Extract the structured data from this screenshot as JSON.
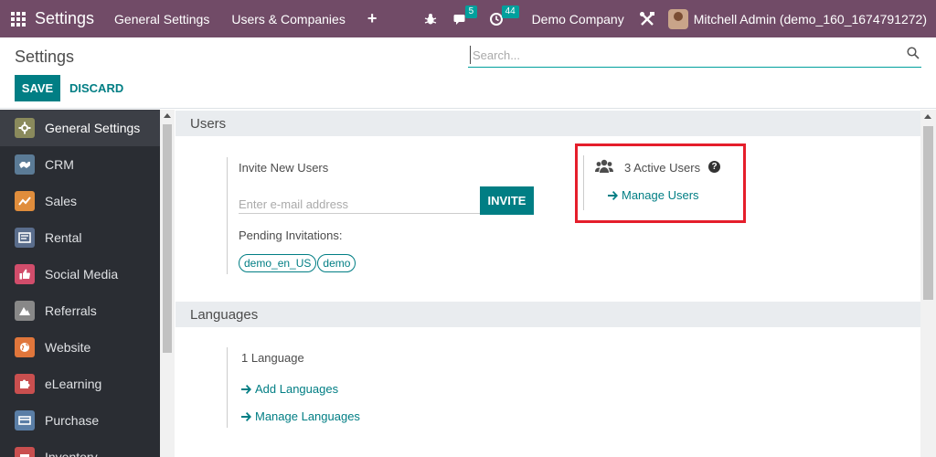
{
  "navbar": {
    "brand": "Settings",
    "menu": [
      "General Settings",
      "Users & Companies"
    ],
    "plus": "+",
    "messages_count": "5",
    "activities_count": "44",
    "company": "Demo Company",
    "user": "Mitchell Admin (demo_160_1674791272)"
  },
  "control_panel": {
    "title": "Settings",
    "search_placeholder": "Search...",
    "save_label": "SAVE",
    "discard_label": "DISCARD"
  },
  "sidebar": {
    "items": [
      {
        "label": "General Settings",
        "icon": "gear-icon",
        "color": "#8a8a5c"
      },
      {
        "label": "CRM",
        "icon": "handshake-icon",
        "color": "#5b7b96"
      },
      {
        "label": "Sales",
        "icon": "chart-icon",
        "color": "#e08d3c"
      },
      {
        "label": "Rental",
        "icon": "rental-icon",
        "color": "#5a6d8c"
      },
      {
        "label": "Social Media",
        "icon": "thumbs-up-icon",
        "color": "#d14d6b"
      },
      {
        "label": "Referrals",
        "icon": "mountain-icon",
        "color": "#888888"
      },
      {
        "label": "Website",
        "icon": "globe-icon",
        "color": "#e0763b"
      },
      {
        "label": "eLearning",
        "icon": "puzzle-icon",
        "color": "#c94f4f"
      },
      {
        "label": "Purchase",
        "icon": "card-icon",
        "color": "#5a7ea6"
      },
      {
        "label": "Inventory",
        "icon": "box-icon",
        "color": "#c94f4f"
      }
    ]
  },
  "users_section": {
    "header": "Users",
    "invite_title": "Invite New Users",
    "email_placeholder": "Enter e-mail address",
    "invite_label": "INVITE",
    "pending_label": "Pending Invitations:",
    "pending_tags": [
      "demo_en_US",
      "demo"
    ],
    "active_users": "3 Active Users",
    "help_glyph": "?",
    "manage_users": "Manage Users"
  },
  "languages_section": {
    "header": "Languages",
    "count": "1 Language",
    "add_languages": "Add Languages",
    "manage_languages": "Manage Languages"
  },
  "colors": {
    "navbar": "#714b67",
    "primary": "#017e84",
    "sidebar": "#2a2d33",
    "highlight": "#e51e2b"
  }
}
